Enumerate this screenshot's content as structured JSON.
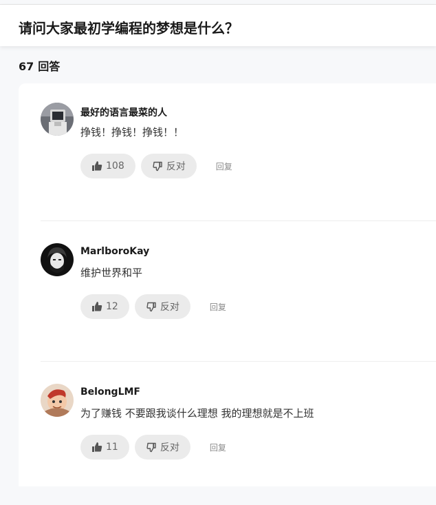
{
  "question": {
    "title": "请问大家最初学编程的梦想是什么？"
  },
  "answers_summary": {
    "count": "67",
    "label": "回答"
  },
  "answers": [
    {
      "author": "最好的语言最菜的人",
      "content": "挣钱！挣钱！挣钱！！",
      "likes": "108",
      "oppose_label": "反对",
      "reply_label": "回复",
      "avatar_icon": "computer-head-avatar"
    },
    {
      "author": "MarlboroKay",
      "content": "维护世界和平",
      "likes": "12",
      "oppose_label": "反对",
      "reply_label": "回复",
      "avatar_icon": "portrait-avatar"
    },
    {
      "author": "BelongLMF",
      "content": "为了赚钱 不要跟我谈什么理想 我的理想就是不上班",
      "likes": "11",
      "oppose_label": "反对",
      "reply_label": "回复",
      "avatar_icon": "cartoon-avatar"
    }
  ],
  "colors": {
    "page_bg": "#f7f8fa",
    "card_bg": "#ffffff",
    "pill_bg": "#ebebeb",
    "muted_text": "#666666"
  }
}
